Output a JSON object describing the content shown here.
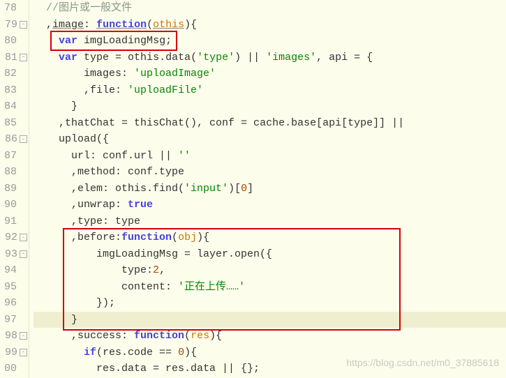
{
  "gutter": {
    "lines": [
      {
        "num": "78",
        "fold": ""
      },
      {
        "num": "79",
        "fold": "-"
      },
      {
        "num": "80",
        "fold": ""
      },
      {
        "num": "81",
        "fold": "-"
      },
      {
        "num": "82",
        "fold": ""
      },
      {
        "num": "83",
        "fold": ""
      },
      {
        "num": "84",
        "fold": ""
      },
      {
        "num": "85",
        "fold": ""
      },
      {
        "num": "86",
        "fold": "-"
      },
      {
        "num": "87",
        "fold": ""
      },
      {
        "num": "88",
        "fold": ""
      },
      {
        "num": "89",
        "fold": ""
      },
      {
        "num": "90",
        "fold": ""
      },
      {
        "num": "91",
        "fold": ""
      },
      {
        "num": "92",
        "fold": "-"
      },
      {
        "num": "93",
        "fold": "-"
      },
      {
        "num": "94",
        "fold": ""
      },
      {
        "num": "95",
        "fold": ""
      },
      {
        "num": "96",
        "fold": ""
      },
      {
        "num": "97",
        "fold": ""
      },
      {
        "num": "98",
        "fold": "-"
      },
      {
        "num": "99",
        "fold": "-"
      },
      {
        "num": "00",
        "fold": ""
      }
    ]
  },
  "code": {
    "l78_comment": "//图片或一般文件",
    "l79_image": "image",
    "l79_function": "function",
    "l79_othis": "othis",
    "l80_var": "var",
    "l80_imgLoadingMsg": "imgLoadingMsg;",
    "l81_var": "var",
    "l81_type": "type = othis.data(",
    "l81_str1": "'type'",
    "l81_mid": ") || ",
    "l81_str2": "'images'",
    "l81_end": ", api = {",
    "l82_images": "images: ",
    "l82_str": "'uploadImage'",
    "l83_file": ",file: ",
    "l83_str": "'uploadFile'",
    "l84": "}",
    "l85": ",thatChat = thisChat(), conf = cache.base[api[type]] || ",
    "l86": "upload({",
    "l87_url": "url: conf.url || ",
    "l87_str": "''",
    "l88": ",method: conf.type",
    "l89_elem": ",elem: othis.find(",
    "l89_str": "'input'",
    "l89_end": ")[",
    "l89_num": "0",
    "l89_close": "]",
    "l90_unwrap": ",unwrap: ",
    "l90_true": "true",
    "l91": ",type: type",
    "l92_before": ",before:",
    "l92_function": "function",
    "l92_obj": "obj",
    "l93": "imgLoadingMsg = layer.open({",
    "l94_type": "type:",
    "l94_num": "2",
    "l95_content": "content: ",
    "l95_str": "'正在上传……'",
    "l96": "});",
    "l97": "}",
    "l98_success": ",success: ",
    "l98_function": "function",
    "l98_res": "res",
    "l99_if": "if",
    "l99_cond": "(res.code == ",
    "l99_num": "0",
    "l99_end": "){",
    "l00": "res.data = res.data || {};"
  },
  "watermark": "https://blog.csdn.net/m0_37885618"
}
